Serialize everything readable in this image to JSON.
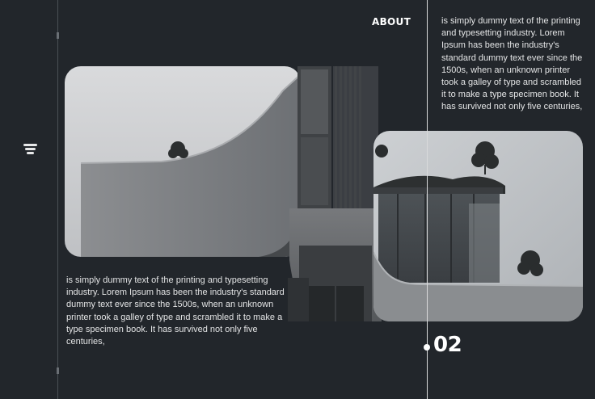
{
  "nav": {
    "menu_icon": "hamburger-menu-icon"
  },
  "about": {
    "title": "ABOUT",
    "text": "is simply dummy text of the printing and typesetting industry. Lorem Ipsum has been the industry's standard dummy text ever since the 1500s, when an unknown printer took a galley of type and scrambled it to make a type specimen book. It has survived not only five centuries,"
  },
  "intro": {
    "text": "is simply dummy text of the printing and typesetting industry. Lorem Ipsum has been the industry's standard dummy text ever since the 1500s, when an unknown printer took a galley of type and scrambled it to make a type specimen book. It has survived not only five centuries,"
  },
  "slide": {
    "number": "02"
  },
  "colors": {
    "background": "#22262b",
    "accent": "#ffffff"
  }
}
